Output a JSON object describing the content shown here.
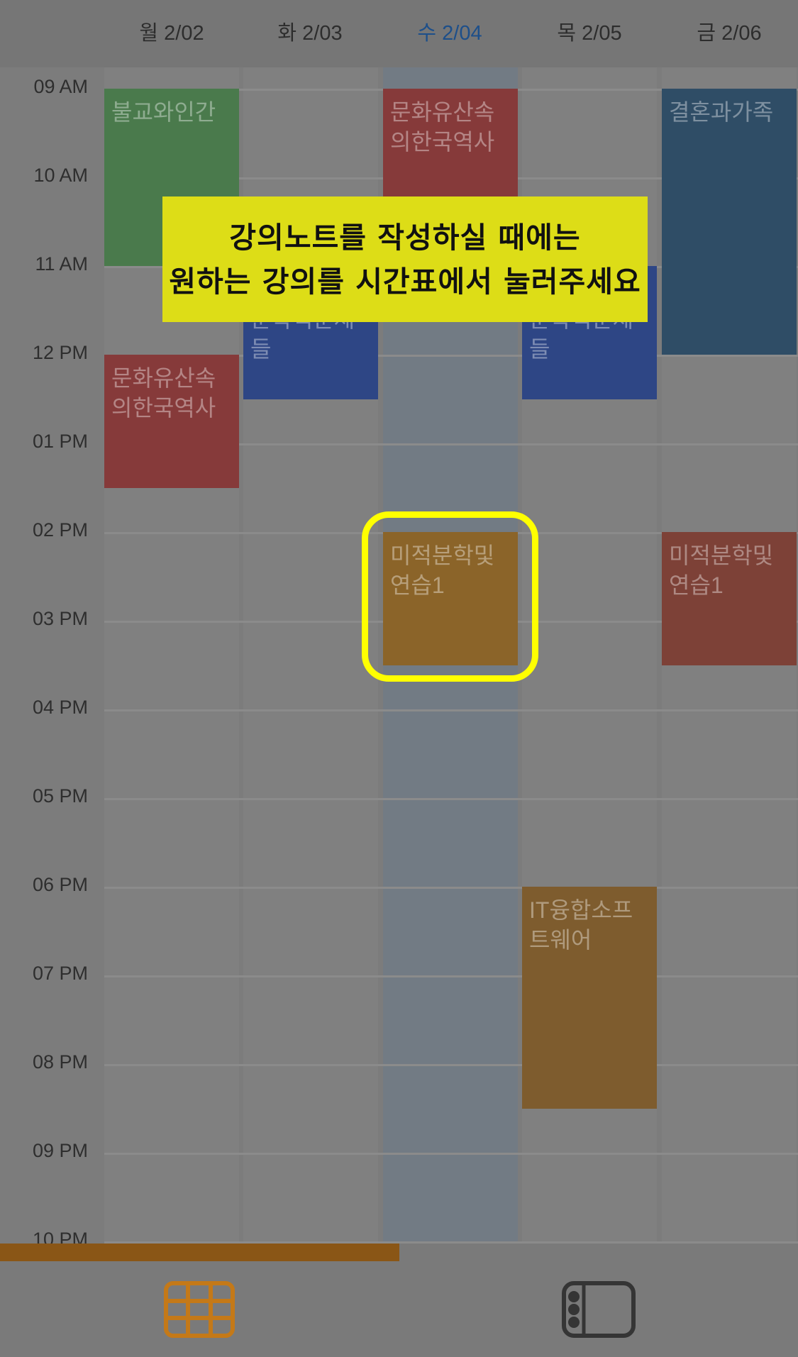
{
  "days": [
    {
      "label": "월 2/02",
      "today": false
    },
    {
      "label": "화 2/03",
      "today": false
    },
    {
      "label": "수 2/04",
      "today": true
    },
    {
      "label": "목 2/05",
      "today": false
    },
    {
      "label": "금 2/06",
      "today": false
    }
  ],
  "times": [
    "09 AM",
    "10 AM",
    "11 AM",
    "12 PM",
    "01 PM",
    "02 PM",
    "03 PM",
    "04 PM",
    "05 PM",
    "06 PM",
    "07 PM",
    "08 PM",
    "09 PM",
    "10 PM"
  ],
  "events": [
    {
      "title": "불교와인간",
      "day": 0,
      "start": 9,
      "end": 11,
      "color": "#4a7a4c"
    },
    {
      "title": "문화유산속의한국역사",
      "day": 0,
      "start": 12,
      "end": 13.5,
      "color": "#863a3a"
    },
    {
      "title": "현대사회와문학적문제들",
      "day": 1,
      "start": 11,
      "end": 12.5,
      "color": "#2e4685"
    },
    {
      "title": "문화유산속의한국역사",
      "day": 2,
      "start": 9,
      "end": 10.5,
      "color": "#863a3a"
    },
    {
      "title": "미적분학및연습1",
      "day": 2,
      "start": 14,
      "end": 15.5,
      "color": "#8b6429"
    },
    {
      "title": "현대사회와문학적문제들",
      "day": 3,
      "start": 11,
      "end": 12.5,
      "color": "#2e4685"
    },
    {
      "title": "IT융합소프트웨어",
      "day": 3,
      "start": 18,
      "end": 20.5,
      "color": "#7e5c2e"
    },
    {
      "title": "결혼과가족",
      "day": 4,
      "start": 9,
      "end": 12,
      "color": "#2f4d66"
    },
    {
      "title": "미적분학및연습1",
      "day": 4,
      "start": 14,
      "end": 15.5,
      "color": "#7d4137"
    }
  ],
  "tooltip": {
    "line1": "강의노트를 작성하실 때에는",
    "line2": "원하는 강의를 시간표에서 눌러주세요"
  },
  "progress": 0.5,
  "tabs": [
    {
      "icon": "grid-timetable-icon",
      "active": true
    },
    {
      "icon": "list-view-icon",
      "active": false
    }
  ],
  "colors": {
    "accent": "#e08a1c",
    "today_header": "#1d4f8a",
    "highlight": "#ffff00",
    "tooltip_bg": "#dddd17"
  }
}
